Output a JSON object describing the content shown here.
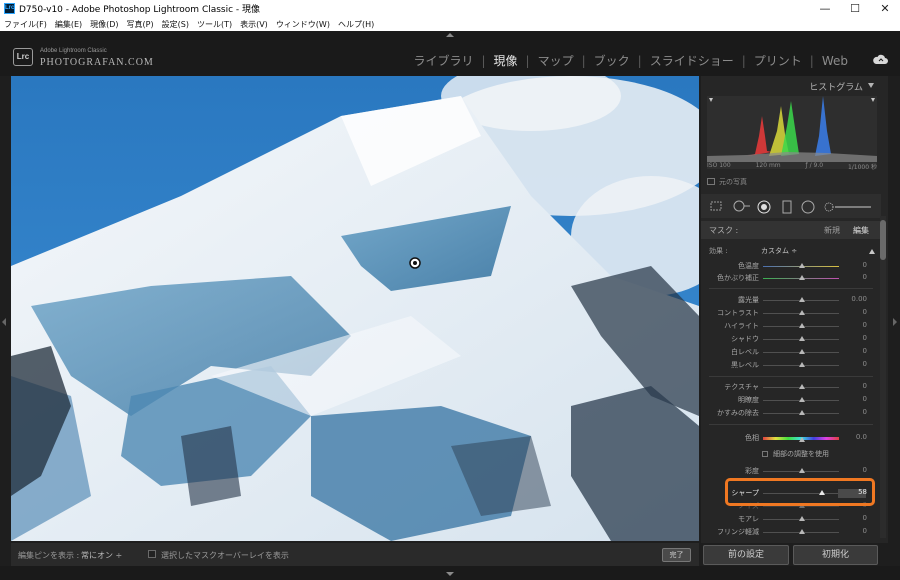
{
  "window": {
    "app_icon": "Lrc",
    "title": "D750-v10 - Adobe Photoshop Lightroom Classic - 現像",
    "minimize": "—",
    "maximize": "☐",
    "close": "✕"
  },
  "menu": [
    "ファイル(F)",
    "編集(E)",
    "現像(D)",
    "写真(P)",
    "設定(S)",
    "ツール(T)",
    "表示(V)",
    "ウィンドウ(W)",
    "ヘルプ(H)"
  ],
  "identity": {
    "badge": "Lrc",
    "brand_small": "Adobe Lightroom Classic",
    "brand_big": "PHOTOGRAFAN.COM"
  },
  "modules": [
    {
      "label": "ライブラリ",
      "active": false
    },
    {
      "label": "現像",
      "active": true
    },
    {
      "label": "マップ",
      "active": false
    },
    {
      "label": "ブック",
      "active": false
    },
    {
      "label": "スライドショー",
      "active": false
    },
    {
      "label": "プリント",
      "active": false
    },
    {
      "label": "Web",
      "active": false
    }
  ],
  "toolbar": {
    "pin_label": "編集ピンを表示 :",
    "pin_value": "常にオン ÷",
    "overlay_label": "選択したマスクオーバーレイを表示",
    "done": "完了"
  },
  "histogram": {
    "title": "ヒストグラム",
    "iso": "ISO 100",
    "focal": "120 mm",
    "aperture": "ƒ / 9.0",
    "shutter": "1/1000 秒",
    "original_photo": "元の写真"
  },
  "mask": {
    "label": "マスク :",
    "new": "新規",
    "edit": "編集"
  },
  "effect": {
    "label": "効果 :",
    "value": "カスタム ÷"
  },
  "sliders": [
    {
      "label": "色温度",
      "value": "0",
      "pos": 0.5,
      "track": "temp"
    },
    {
      "label": "色かぶり補正",
      "value": "0",
      "pos": 0.5,
      "track": "tint"
    },
    {
      "label": "露光量",
      "value": "0.00",
      "pos": 0.5,
      "track": "plain"
    },
    {
      "label": "コントラスト",
      "value": "0",
      "pos": 0.5,
      "track": "plain"
    },
    {
      "label": "ハイライト",
      "value": "0",
      "pos": 0.5,
      "track": "plain"
    },
    {
      "label": "シャドウ",
      "value": "0",
      "pos": 0.5,
      "track": "plain"
    },
    {
      "label": "白レベル",
      "value": "0",
      "pos": 0.5,
      "track": "plain"
    },
    {
      "label": "黒レベル",
      "value": "0",
      "pos": 0.5,
      "track": "plain"
    },
    {
      "label": "テクスチャ",
      "value": "0",
      "pos": 0.5,
      "track": "plain"
    },
    {
      "label": "明瞭度",
      "value": "0",
      "pos": 0.5,
      "track": "plain"
    },
    {
      "label": "かすみの除去",
      "value": "0",
      "pos": 0.5,
      "track": "plain"
    },
    {
      "label": "色相",
      "value": "0.0",
      "pos": 0.5,
      "track": "hue"
    },
    {
      "label": "彩度",
      "value": "0",
      "pos": 0.5,
      "track": "plain"
    },
    {
      "label": "シャープ",
      "value": "58",
      "pos": 0.79,
      "track": "plain"
    },
    {
      "label": "ノイズ",
      "value": "0",
      "pos": 0.5,
      "track": "plain"
    },
    {
      "label": "モアレ",
      "value": "0",
      "pos": 0.5,
      "track": "plain"
    },
    {
      "label": "フリンジ軽減",
      "value": "0",
      "pos": 0.5,
      "track": "plain"
    }
  ],
  "fine_hue": "細部の調整を使用",
  "buttons": {
    "previous": "前の設定",
    "reset": "初期化"
  }
}
